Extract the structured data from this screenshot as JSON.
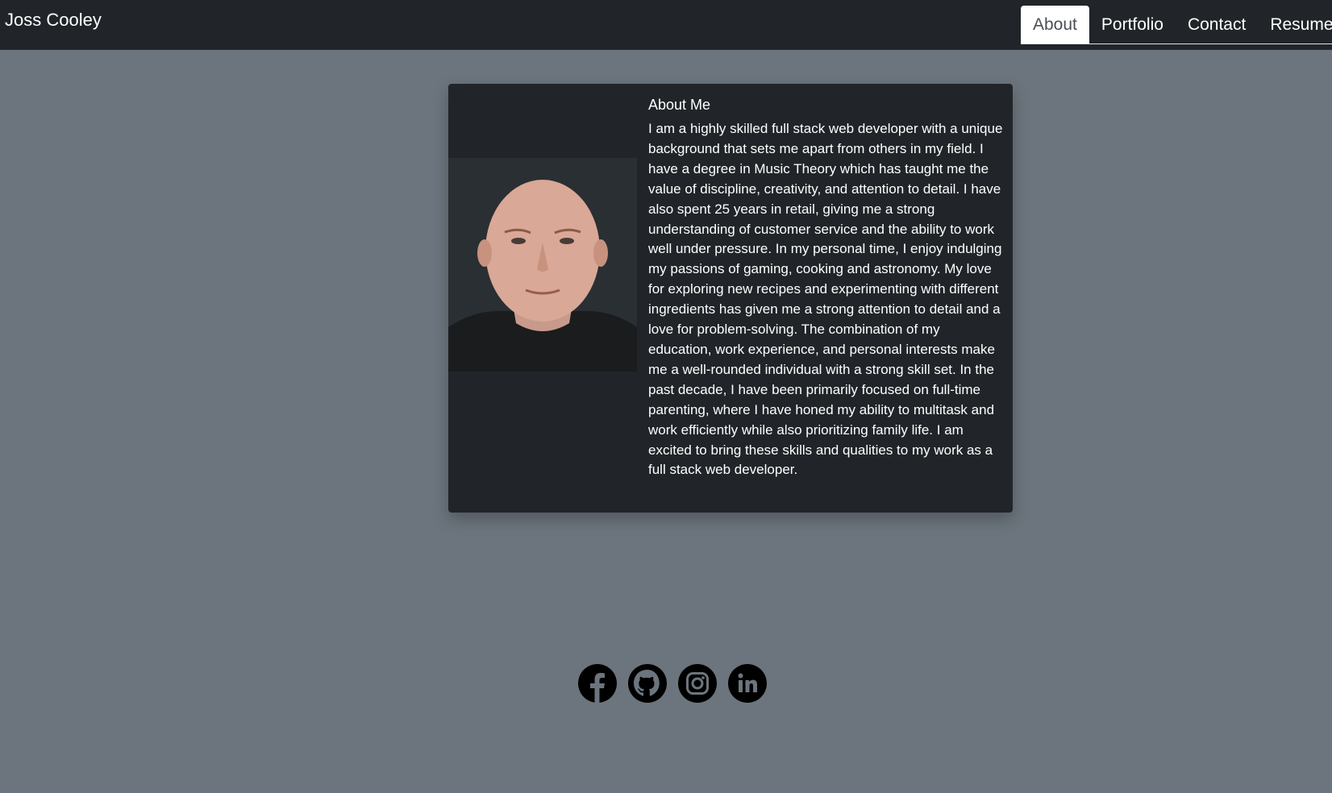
{
  "navbar": {
    "brand": "Joss Cooley",
    "tabs": [
      {
        "label": "About",
        "active": true
      },
      {
        "label": "Portfolio",
        "active": false
      },
      {
        "label": "Contact",
        "active": false
      },
      {
        "label": "Resume",
        "active": false
      }
    ]
  },
  "about": {
    "title": "About Me",
    "body": "I am a highly skilled full stack web developer with a unique background that sets me apart from others in my field. I have a degree in Music Theory which has taught me the value of discipline, creativity, and attention to detail. I have also spent 25 years in retail, giving me a strong understanding of customer service and the ability to work well under pressure. In my personal time, I enjoy indulging my passions of gaming, cooking and astronomy. My love for exploring new recipes and experimenting with different ingredients has given me a strong attention to detail and a love for problem-solving. The combination of my education, work experience, and personal interests make me a well-rounded individual with a strong skill set. In the past decade, I have been primarily focused on full-time parenting, where I have honed my ability to multitask and work efficiently while also prioritizing family life. I am excited to bring these skills and qualities to my work as a full stack web developer."
  },
  "footer": {
    "social_icons": [
      "facebook-icon",
      "github-icon",
      "instagram-icon",
      "linkedin-icon"
    ]
  },
  "colors": {
    "page_background": "#6c757d",
    "navbar_background": "#212529",
    "card_background": "#212529",
    "active_tab_background": "#ffffff"
  }
}
